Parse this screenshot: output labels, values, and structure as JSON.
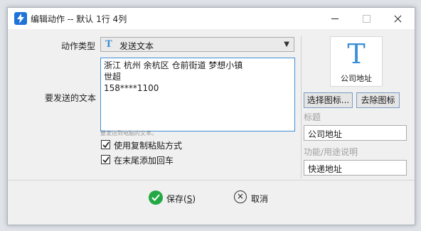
{
  "window": {
    "title": "编辑动作 -- 默认 1行 4列",
    "accent_color": "#1f73d8"
  },
  "form": {
    "action_type_label": "动作类型",
    "action_type_value": "发送文本",
    "action_type_icon": "T-icon",
    "text_label": "要发送的文本",
    "text_lines": [
      "浙江 杭州 余杭区 仓前街道 梦想小镇",
      "世超",
      "158****1100"
    ],
    "text_hint": "要发送到电脑的文本。",
    "checkbox_paste": {
      "label": "使用复制粘贴方式",
      "checked": true
    },
    "checkbox_enter": {
      "label": "在末尾添加回车",
      "checked": true
    }
  },
  "sidebar": {
    "icon_caption": "公司地址",
    "choose_icon_label": "选择图标...",
    "remove_icon_label": "去除图标",
    "title_label": "标题",
    "title_value": "公司地址",
    "desc_label": "功能/用途说明",
    "desc_value": "快递地址"
  },
  "footer": {
    "save_label": "保存(",
    "save_key": "S",
    "save_close": ")",
    "cancel_label": "取消"
  }
}
